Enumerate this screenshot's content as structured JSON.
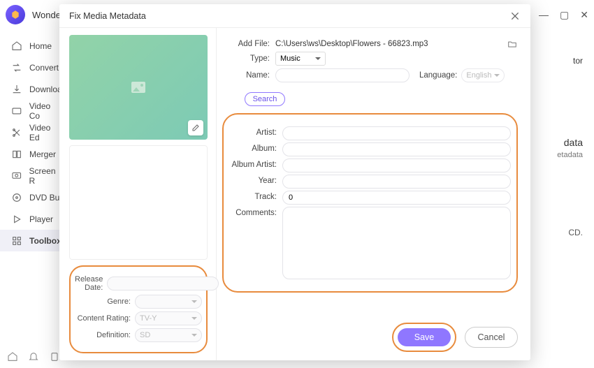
{
  "app": {
    "title": "Wonder"
  },
  "sidebar": {
    "items": [
      {
        "label": "Home"
      },
      {
        "label": "Convert"
      },
      {
        "label": "Downloa"
      },
      {
        "label": "Video Co"
      },
      {
        "label": "Video Ed"
      },
      {
        "label": "Merger"
      },
      {
        "label": "Screen R"
      },
      {
        "label": "DVD Bur"
      },
      {
        "label": "Player"
      },
      {
        "label": "Toolbox"
      }
    ]
  },
  "snippets": {
    "a": "tor",
    "b": "data",
    "c": "etadata",
    "d": "CD."
  },
  "modal": {
    "title": "Fix Media Metadata",
    "addFileLabel": "Add File:",
    "addFilePath": "C:\\Users\\ws\\Desktop\\Flowers - 66823.mp3",
    "typeLabel": "Type:",
    "typeValue": "Music",
    "nameLabel": "Name:",
    "nameValue": "",
    "languageLabel": "Language:",
    "languageValue": "English",
    "searchLabel": "Search",
    "fields": {
      "artistLabel": "Artist:",
      "albumLabel": "Album:",
      "albumArtistLabel": "Album Artist:",
      "yearLabel": "Year:",
      "trackLabel": "Track:",
      "trackValue": "0",
      "commentsLabel": "Comments:"
    },
    "leftFields": {
      "releaseDateLabel": "Release Date:",
      "genreLabel": "Genre:",
      "contentRatingLabel": "Content Rating:",
      "contentRatingValue": "TV-Y",
      "definitionLabel": "Definition:",
      "definitionValue": "SD"
    },
    "saveLabel": "Save",
    "cancelLabel": "Cancel"
  }
}
